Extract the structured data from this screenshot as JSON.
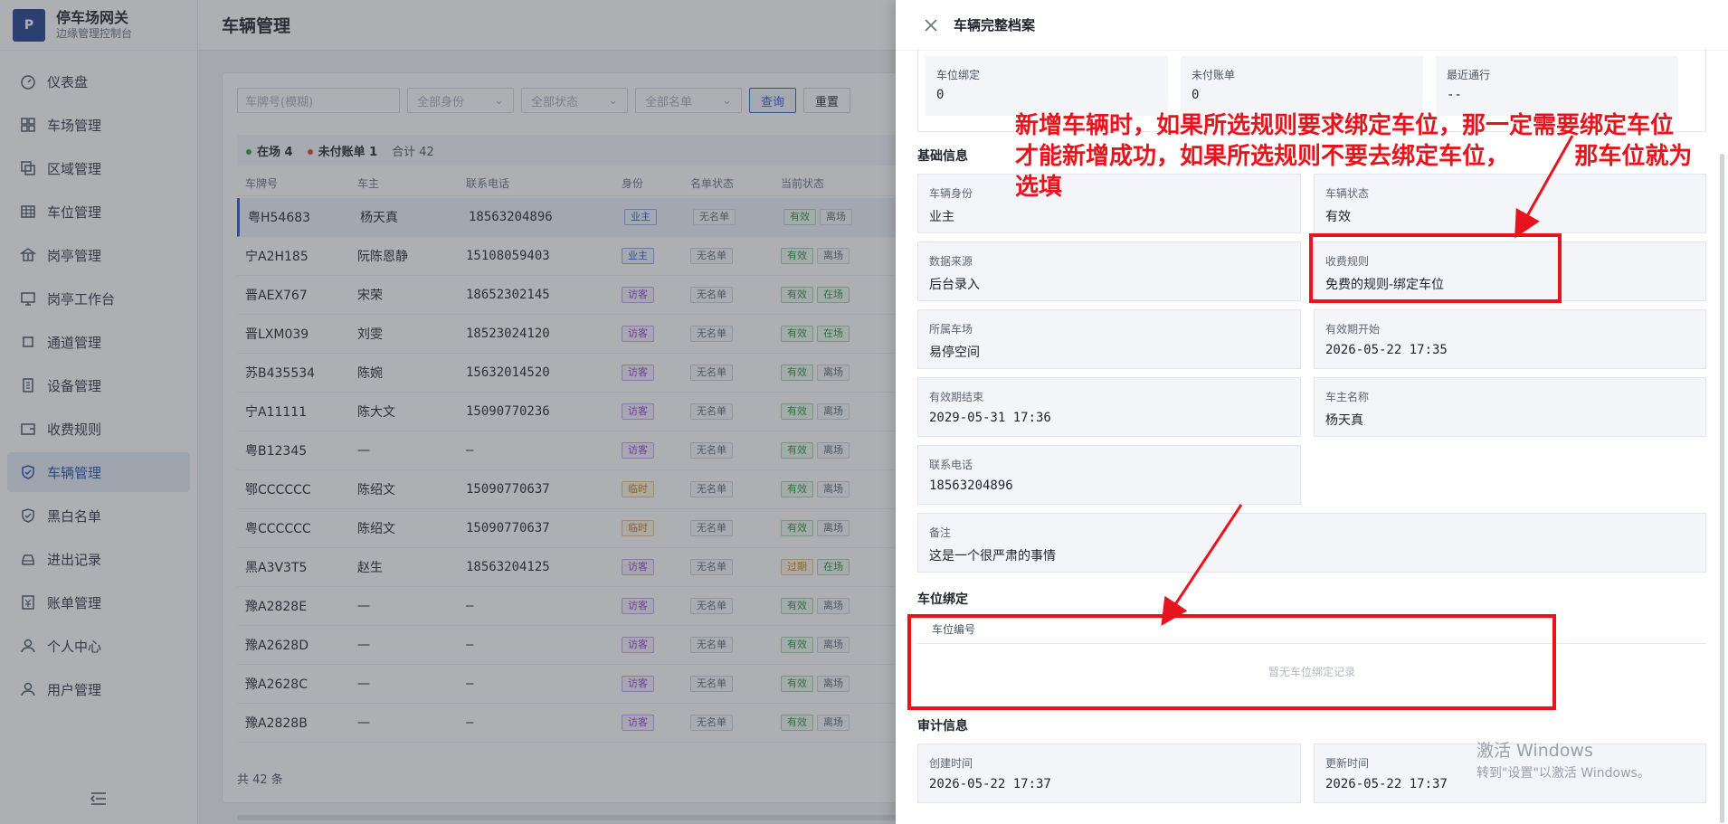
{
  "brand": {
    "logo": "P",
    "title": "停车场网关",
    "subtitle": "边缘管理控制台"
  },
  "nav": [
    {
      "label": "仪表盘",
      "icon": "dashboard-icon"
    },
    {
      "label": "车场管理",
      "icon": "grid-icon"
    },
    {
      "label": "区域管理",
      "icon": "layers-icon"
    },
    {
      "label": "车位管理",
      "icon": "table-icon"
    },
    {
      "label": "岗亭管理",
      "icon": "bank-icon"
    },
    {
      "label": "岗亭工作台",
      "icon": "monitor-icon"
    },
    {
      "label": "通道管理",
      "icon": "channel-icon"
    },
    {
      "label": "设备管理",
      "icon": "device-icon"
    },
    {
      "label": "收费规则",
      "icon": "wallet-icon"
    },
    {
      "label": "车辆管理",
      "icon": "shield-icon",
      "active": true
    },
    {
      "label": "黑白名单",
      "icon": "shield-check-icon"
    },
    {
      "label": "进出记录",
      "icon": "car-icon"
    },
    {
      "label": "账单管理",
      "icon": "bill-icon"
    },
    {
      "label": "个人中心",
      "icon": "user-icon"
    },
    {
      "label": "用户管理",
      "icon": "users-icon"
    }
  ],
  "page": {
    "title": "车辆管理"
  },
  "filters": {
    "plate_placeholder": "车牌号(模糊)",
    "identity": "全部身份",
    "status": "全部状态",
    "list": "全部名单",
    "query": "查询",
    "reset": "重置"
  },
  "summary": {
    "in": "在场 4",
    "unpaid": "未付账单 1",
    "total": "合计 42"
  },
  "table": {
    "headers": [
      "车牌号",
      "车主",
      "联系电话",
      "身份",
      "名单状态",
      "当前状态"
    ],
    "rows": [
      {
        "plate": "粤H54683",
        "owner": "杨天真",
        "phone": "18563204896",
        "identity": "业主",
        "idtype": "owner",
        "list": "无名单",
        "valid": "有效",
        "vtype": "ok",
        "pos": "离场",
        "ptype": "out"
      },
      {
        "plate": "宁A2H185",
        "owner": "阮陈恩静",
        "phone": "15108059403",
        "identity": "业主",
        "idtype": "owner",
        "list": "无名单",
        "valid": "有效",
        "vtype": "ok",
        "pos": "离场",
        "ptype": "out"
      },
      {
        "plate": "晋AEX767",
        "owner": "宋荣",
        "phone": "18652302145",
        "identity": "访客",
        "idtype": "visit",
        "list": "无名单",
        "valid": "有效",
        "vtype": "ok",
        "pos": "在场",
        "ptype": "in"
      },
      {
        "plate": "晋LXM039",
        "owner": "刘雯",
        "phone": "18523024120",
        "identity": "访客",
        "idtype": "visit",
        "list": "无名单",
        "valid": "有效",
        "vtype": "ok",
        "pos": "在场",
        "ptype": "in"
      },
      {
        "plate": "苏B435534",
        "owner": "陈婉",
        "phone": "15632014520",
        "identity": "访客",
        "idtype": "visit",
        "list": "无名单",
        "valid": "有效",
        "vtype": "ok",
        "pos": "离场",
        "ptype": "out"
      },
      {
        "plate": "宁A11111",
        "owner": "陈大文",
        "phone": "15090770236",
        "identity": "访客",
        "idtype": "visit",
        "list": "无名单",
        "valid": "有效",
        "vtype": "ok",
        "pos": "离场",
        "ptype": "out"
      },
      {
        "plate": "粤B12345",
        "owner": "—",
        "phone": "–",
        "identity": "访客",
        "idtype": "visit",
        "list": "无名单",
        "valid": "有效",
        "vtype": "ok",
        "pos": "离场",
        "ptype": "out"
      },
      {
        "plate": "鄂CCCCCC",
        "owner": "陈绍文",
        "phone": "15090770637",
        "identity": "临时",
        "idtype": "temp",
        "list": "无名单",
        "valid": "有效",
        "vtype": "ok",
        "pos": "离场",
        "ptype": "out"
      },
      {
        "plate": "粤CCCCCC",
        "owner": "陈绍文",
        "phone": "15090770637",
        "identity": "临时",
        "idtype": "temp",
        "list": "无名单",
        "valid": "有效",
        "vtype": "ok",
        "pos": "离场",
        "ptype": "out"
      },
      {
        "plate": "黑A3V3T5",
        "owner": "赵生",
        "phone": "18563204125",
        "identity": "访客",
        "idtype": "visit",
        "list": "无名单",
        "valid": "过期",
        "vtype": "exp",
        "pos": "在场",
        "ptype": "in"
      },
      {
        "plate": "豫A2828E",
        "owner": "—",
        "phone": "–",
        "identity": "访客",
        "idtype": "visit",
        "list": "无名单",
        "valid": "有效",
        "vtype": "ok",
        "pos": "离场",
        "ptype": "out"
      },
      {
        "plate": "豫A2628D",
        "owner": "—",
        "phone": "–",
        "identity": "访客",
        "idtype": "visit",
        "list": "无名单",
        "valid": "有效",
        "vtype": "ok",
        "pos": "离场",
        "ptype": "out"
      },
      {
        "plate": "豫A2628C",
        "owner": "—",
        "phone": "–",
        "identity": "访客",
        "idtype": "visit",
        "list": "无名单",
        "valid": "有效",
        "vtype": "ok",
        "pos": "离场",
        "ptype": "out"
      },
      {
        "plate": "豫A2828B",
        "owner": "—",
        "phone": "–",
        "identity": "访客",
        "idtype": "visit",
        "list": "无名单",
        "valid": "有效",
        "vtype": "ok",
        "pos": "离场",
        "ptype": "out"
      }
    ],
    "total": "共 42 条"
  },
  "drawer": {
    "title": "车辆完整档案",
    "stats": [
      {
        "label": "车位绑定",
        "value": "0"
      },
      {
        "label": "未付账单",
        "value": "0"
      },
      {
        "label": "最近通行",
        "value": "--"
      }
    ],
    "basic_title": "基础信息",
    "fields": {
      "identity": {
        "label": "车辆身份",
        "value": "业主"
      },
      "status": {
        "label": "车辆状态",
        "value": "有效"
      },
      "source": {
        "label": "数据来源",
        "value": "后台录入"
      },
      "rule": {
        "label": "收费规则",
        "value": "免费的规则-绑定车位"
      },
      "lot": {
        "label": "所属车场",
        "value": "易停空间"
      },
      "start": {
        "label": "有效期开始",
        "value": "2026-05-22 17:35"
      },
      "end": {
        "label": "有效期结束",
        "value": "2029-05-31 17:36"
      },
      "owner": {
        "label": "车主名称",
        "value": "杨天真"
      },
      "phone": {
        "label": "联系电话",
        "value": "18563204896"
      },
      "remark": {
        "label": "备注",
        "value": "这是一个很严肃的事情"
      }
    },
    "binding_title": "车位绑定",
    "binding_col": "车位编号",
    "binding_empty": "暂无车位绑定记录",
    "audit_title": "审计信息",
    "created": {
      "label": "创建时间",
      "value": "2026-05-22 17:37"
    },
    "updated": {
      "label": "更新时间",
      "value": "2026-05-22 17:37"
    }
  },
  "annotation": {
    "line1": "新增车辆时，如果所选规则要求绑定车位，那一定需要绑定车位",
    "line2": "才能新增成功，如果所选规则不要去绑定车位，        那车位就为",
    "line3": "选填",
    "color": "#e8141d"
  },
  "watermark": {
    "line1": "激活 Windows",
    "line2": "转到\"设置\"以激活 Windows。"
  }
}
